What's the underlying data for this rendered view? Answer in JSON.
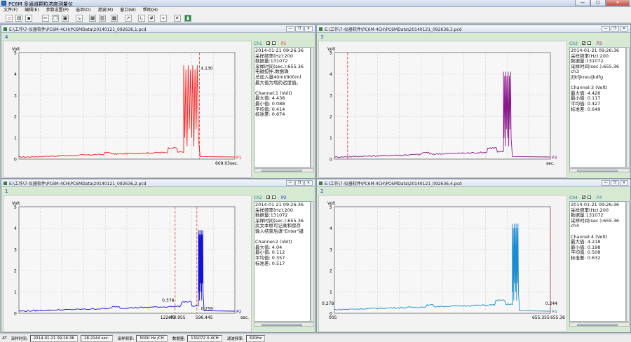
{
  "window": {
    "title": "PC6M 多通道颗粒浓度测量仪",
    "btn_min": "—",
    "btn_max": "□",
    "btn_close": "✕"
  },
  "menu": [
    "文件(F)",
    "编辑(E)",
    "参数设置(P)",
    "选项(O)",
    "滤波(M)",
    "窗口(W)",
    "帮助(H)"
  ],
  "toolbar": [
    "new-icon",
    "open-icon",
    "save-icon",
    "cut-icon",
    "copy-icon",
    "paste-icon",
    "zoom-icon",
    "chart-icon",
    "table-icon",
    "print-icon",
    "export-icon",
    "axis-icon",
    "grid-icon",
    "cursor-icon",
    "close-icon",
    "book-icon"
  ],
  "panels": [
    {
      "path": "E:\\工作\\7-仪器软件\\PC6M-4CH\\PC6MData\\20140121_092636,1.pcd",
      "label": "4",
      "ch": "Ch1",
      "pname": "P1",
      "color": "#ff1a1a",
      "info": [
        "2014-01-21 09:26:36",
        "采样频率(Hz):200",
        "数据量:131072",
        "采样时间(sec.):655.36",
        "电磁搅拌,数据珠",
        "总加入量40ml/900ml",
        "最大值为堵药迟度值。",
        "",
        "Channel:1 (Volt)",
        "最大值: 4.438",
        "最小值: 0.088",
        "平均值: 0.414",
        "标准差: 0.674"
      ],
      "markers_text": [
        "609.03sec."
      ],
      "annot": [
        "4.130"
      ],
      "pend": "P1",
      "chart": {
        "type": "line",
        "ylabel": "Volt",
        "yticks": [
          "0",
          "1",
          "2",
          "3",
          "4",
          "5"
        ],
        "ylim": [
          0,
          5
        ],
        "xlim": [
          0,
          655.36
        ]
      }
    },
    {
      "path": "E:\\工作\\7-仪器软件\\PC6M-4CH\\PC6MData\\20140121_092636,3.pcd",
      "label": "3",
      "ch": "Ch3",
      "pname": "P3",
      "color": "#8b168b",
      "info": [
        "2014-01-21 09:26:36",
        "采样频率(Hz):200",
        "数据量:131072",
        "采样时间(sec.):655.36",
        "ch3",
        "jfjkfjkreuijkdfg",
        "",
        "Channel:3 (Volt)",
        "最大值: 4.426",
        "最小值: 0.117",
        "平均值: 0.427",
        "标准差: 0.649"
      ],
      "markers_text": [
        "sec."
      ],
      "annot": [],
      "pend": "P3",
      "chart": {
        "type": "line",
        "ylabel": "Volt",
        "yticks": [
          "0",
          "1",
          "2",
          "3",
          "4",
          "5"
        ],
        "ylim": [
          0,
          5
        ],
        "xlim": [
          0,
          655.36
        ]
      }
    },
    {
      "path": "E:\\工作\\7-仪器软件\\PC6M-4CH\\PC6MData\\20140121_092636,2.pcd",
      "label": "1",
      "ch": "Ch2",
      "pname": "P2",
      "color": "#1010e0",
      "info": [
        "2014-01-21 09:26:36",
        "采样频率(Hz):200",
        "数据量:131072",
        "采样时间(sec.):655.36",
        "此文本框可记录和保存",
        "输入结束后请\"Enter\"键",
        "",
        "Channel:2 (Volt)",
        "最大值: 4.04",
        "最小值: 0.112",
        "平均值: 0.357",
        "标准差: 0.517"
      ],
      "markers_text": [
        "473.955",
        "122.49",
        "596.445",
        "sec."
      ],
      "annot": [
        "0.378",
        "0.259"
      ],
      "pend": "P2",
      "chart": {
        "type": "line",
        "ylabel": "Volt",
        "yticks": [
          "0",
          "1",
          "2",
          "3",
          "4",
          "5"
        ],
        "ylim": [
          0,
          5
        ],
        "xlim": [
          0,
          655.36
        ]
      }
    },
    {
      "path": "E:\\工作\\7-仪器软件\\PC6M-4CH\\PC6MData\\20140121_092636,4.pcd",
      "label": "2",
      "ch": "Ch4",
      "pname": "P4",
      "color": "#1a8bd0",
      "info": [
        "2014-01-21 09:26:36",
        "采样频率(Hz):200",
        "数据量:131072",
        "采样时间(sec.):655.36",
        "ch4",
        "",
        "Channel:4 (Volt)",
        "最大值: 4.218",
        "最小值: 0.198",
        "平均值: 0.508",
        "标准差: 0.632"
      ],
      "markers_text": [
        "005",
        "655.355",
        "655.36"
      ],
      "annot": [
        "0.278",
        "0.244"
      ],
      "pend": "P4",
      "chart": {
        "type": "line",
        "ylabel": "Volt",
        "yticks": [
          "0",
          "1",
          "2",
          "3",
          "4",
          "5"
        ],
        "ylim": [
          0,
          5
        ],
        "xlim": [
          0,
          655.36
        ]
      }
    }
  ],
  "status": [
    {
      "k": "采样时间:",
      "v": "2014-01-21 09:26:36"
    },
    {
      "k": "",
      "v": "28.2144 sec."
    },
    {
      "k": "采样频率:",
      "v": "5000 Hz /CH"
    },
    {
      "k": "数据量:",
      "v": "131072 X 4CH"
    },
    {
      "k": "滤波频率:",
      "v": "500Hz"
    }
  ],
  "status_prefix": "AT"
}
